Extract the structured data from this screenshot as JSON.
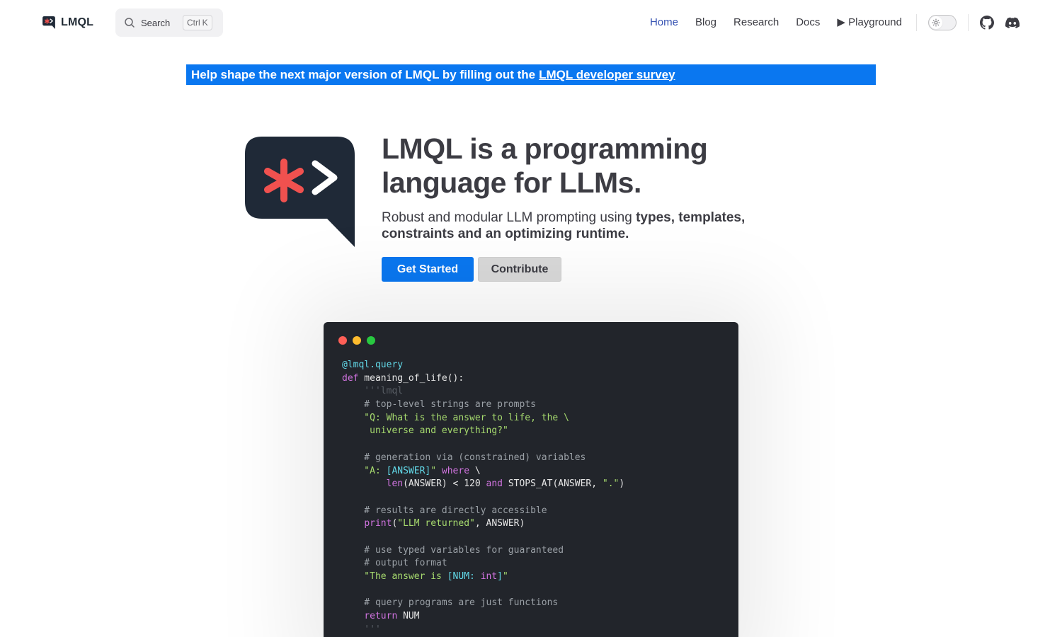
{
  "nav": {
    "brand": "LMQL",
    "search": {
      "label": "Search",
      "kbd_ctrl": "Ctrl",
      "kbd_key": "K"
    },
    "links": [
      {
        "label": "Home",
        "active": true
      },
      {
        "label": "Blog",
        "active": false
      },
      {
        "label": "Research",
        "active": false
      },
      {
        "label": "Docs",
        "active": false
      },
      {
        "label": "▶ Playground",
        "active": false
      }
    ],
    "icons": [
      "sun-icon",
      "github-icon",
      "discord-icon"
    ]
  },
  "banner": {
    "text": "Help shape the next major version of LMQL by filling out the",
    "link": "LMQL developer survey"
  },
  "hero": {
    "title": "LMQL is a programming language for LLMs.",
    "subtitle_prefix": "Robust and modular LLM prompting using ",
    "subtitle_bold": "types, templates, constraints and an optimizing runtime.",
    "primary_button": "Get Started",
    "secondary_button": "Contribute"
  },
  "code_window": {
    "dots_colors": [
      "#ff5f57",
      "#febc2e",
      "#28c840"
    ],
    "lines": [
      [
        {
          "t": "@lmql.query",
          "c": "c-dec"
        }
      ],
      [
        {
          "t": "def",
          "c": "c-kw"
        },
        {
          "t": " meaning_of_life():",
          "c": "c-fn"
        }
      ],
      [
        {
          "t": "    '''lmql",
          "c": "c-doc"
        }
      ],
      [
        {
          "t": "    # top-level strings are prompts",
          "c": "c-com"
        }
      ],
      [
        {
          "t": "    \"Q: What is the answer to life, the \\",
          "c": "c-str"
        }
      ],
      [
        {
          "t": "     universe and everything?\"",
          "c": "c-str"
        }
      ],
      [
        {
          "t": "",
          "c": "c-fn"
        }
      ],
      [
        {
          "t": "    # generation via (constrained) variables",
          "c": "c-com"
        }
      ],
      [
        {
          "t": "    \"A: ",
          "c": "c-str"
        },
        {
          "t": "[ANSWER]",
          "c": "c-var"
        },
        {
          "t": "\"",
          "c": "c-str"
        },
        {
          "t": " where",
          "c": "c-kw"
        },
        {
          "t": " \\",
          "c": "c-fn"
        }
      ],
      [
        {
          "t": "        ",
          "c": "c-fn"
        },
        {
          "t": "len",
          "c": "c-bi"
        },
        {
          "t": "(ANSWER) < 120 ",
          "c": "c-fn"
        },
        {
          "t": "and",
          "c": "c-kw"
        },
        {
          "t": " STOPS_AT(ANSWER, ",
          "c": "c-fn"
        },
        {
          "t": "\".\"",
          "c": "c-str"
        },
        {
          "t": ")",
          "c": "c-fn"
        }
      ],
      [
        {
          "t": "",
          "c": "c-fn"
        }
      ],
      [
        {
          "t": "    # results are directly accessible",
          "c": "c-com"
        }
      ],
      [
        {
          "t": "    ",
          "c": "c-fn"
        },
        {
          "t": "print",
          "c": "c-bi"
        },
        {
          "t": "(",
          "c": "c-fn"
        },
        {
          "t": "\"LLM returned\"",
          "c": "c-str"
        },
        {
          "t": ", ANSWER)",
          "c": "c-fn"
        }
      ],
      [
        {
          "t": "",
          "c": "c-fn"
        }
      ],
      [
        {
          "t": "    # use typed variables for guaranteed",
          "c": "c-com"
        }
      ],
      [
        {
          "t": "    # output format",
          "c": "c-com"
        }
      ],
      [
        {
          "t": "    \"The answer is ",
          "c": "c-str"
        },
        {
          "t": "[NUM: ",
          "c": "c-var"
        },
        {
          "t": "int",
          "c": "c-kw"
        },
        {
          "t": "]",
          "c": "c-var"
        },
        {
          "t": "\"",
          "c": "c-str"
        }
      ],
      [
        {
          "t": "",
          "c": "c-fn"
        }
      ],
      [
        {
          "t": "    # query programs are just functions",
          "c": "c-com"
        }
      ],
      [
        {
          "t": "    ",
          "c": "c-fn"
        },
        {
          "t": "return",
          "c": "c-kw"
        },
        {
          "t": " NUM",
          "c": "c-fn"
        }
      ],
      [
        {
          "t": "    '''",
          "c": "c-doc"
        }
      ]
    ]
  }
}
